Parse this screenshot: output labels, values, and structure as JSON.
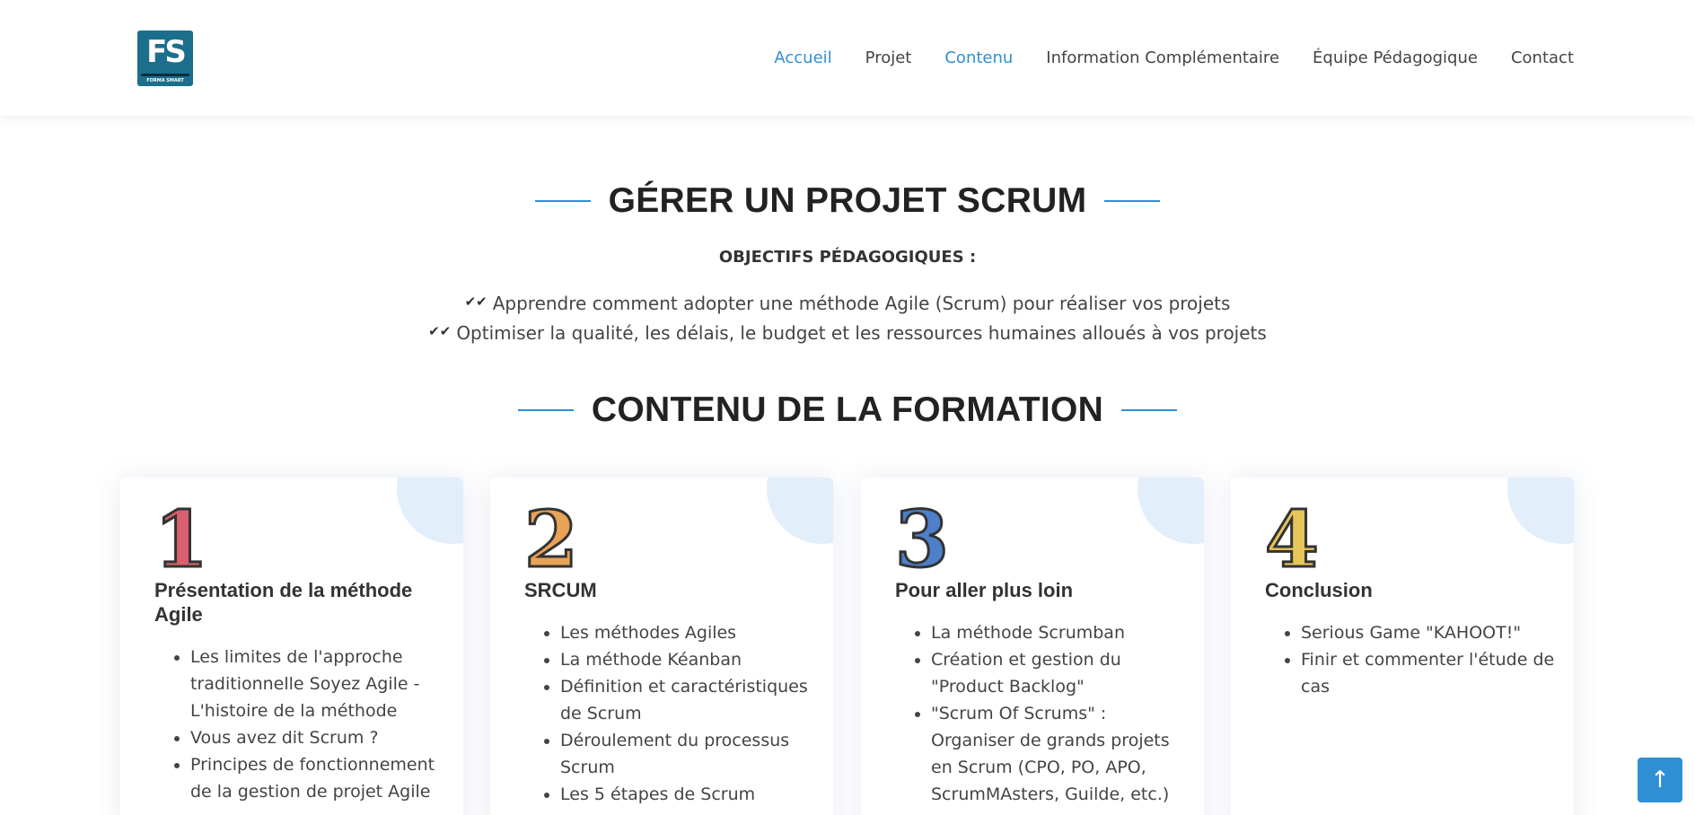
{
  "header": {
    "logo": {
      "letters": "FS",
      "caption": "FORMA SMART"
    },
    "nav": [
      {
        "label": "Accueil",
        "active": true
      },
      {
        "label": "Projet",
        "active": false
      },
      {
        "label": "Contenu",
        "active": true
      },
      {
        "label": "Information Complémentaire",
        "active": false
      },
      {
        "label": "Équipe Pédagogique",
        "active": false
      },
      {
        "label": "Contact",
        "active": false
      }
    ]
  },
  "intro": {
    "title": "GÉRER UN PROJET SCRUM",
    "objectives_heading": "OBJECTIFS PÉDAGOGIQUES :",
    "objectives": [
      "Apprendre comment adopter une méthode Agile (Scrum) pour réaliser vos projets",
      "Optimiser la qualité, les délais, le budget et les ressources humaines alloués à vos projets"
    ]
  },
  "content": {
    "title": "CONTENU DE LA FORMATION",
    "cards": [
      {
        "number": "1",
        "color": "#d9606e",
        "title": "Présentation de la méthode Agile",
        "items": [
          "Les limites de l'approche traditionnelle Soyez Agile - L'histoire de la méthode",
          "Vous avez dit Scrum ?",
          "Principes de fonctionnement de la gestion de projet Agile"
        ]
      },
      {
        "number": "2",
        "color": "#e8a356",
        "title": "SRCUM",
        "items": [
          "Les méthodes Agiles",
          "La méthode Kéanban",
          "Définition et caractéristiques de Scrum",
          "Déroulement du processus Scrum",
          "Les 5 étapes de Scrum"
        ]
      },
      {
        "number": "3",
        "color": "#4d7fca",
        "title": "Pour aller plus loin",
        "items": [
          "La méthode Scrumban",
          "Création et gestion du \"Product Backlog\"",
          "\"Scrum Of Scrums\" : Organiser de grands projets en Scrum (CPO, PO, APO, ScrumMAsters, Guilde, etc.)"
        ]
      },
      {
        "number": "4",
        "color": "#e6c55a",
        "title": "Conclusion",
        "items": [
          "Serious Game \"KAHOOT!\"",
          "Finir et commenter l'étude de cas"
        ]
      }
    ]
  },
  "back_to_top": {
    "icon": "arrow-up-icon",
    "glyph": "↑"
  }
}
